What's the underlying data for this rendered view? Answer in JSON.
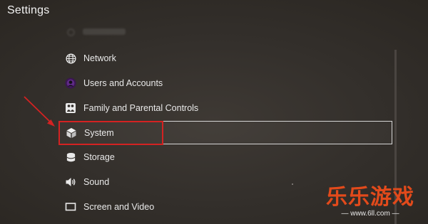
{
  "header": {
    "title": "Settings"
  },
  "settings_list": {
    "items": [
      {
        "label": "Network",
        "icon": "globe-icon"
      },
      {
        "label": "Users and Accounts",
        "icon": "user-avatar-icon"
      },
      {
        "label": "Family and Parental Controls",
        "icon": "family-icon"
      },
      {
        "label": "System",
        "icon": "cube-icon",
        "selected": true
      },
      {
        "label": "Storage",
        "icon": "storage-icon"
      },
      {
        "label": "Sound",
        "icon": "speaker-icon"
      },
      {
        "label": "Screen and Video",
        "icon": "monitor-icon"
      }
    ]
  },
  "annotation": {
    "color": "#d42222"
  },
  "watermark": {
    "brand": "乐乐游戏",
    "url": "— www.6ll.com —",
    "color": "#e24a1b"
  }
}
